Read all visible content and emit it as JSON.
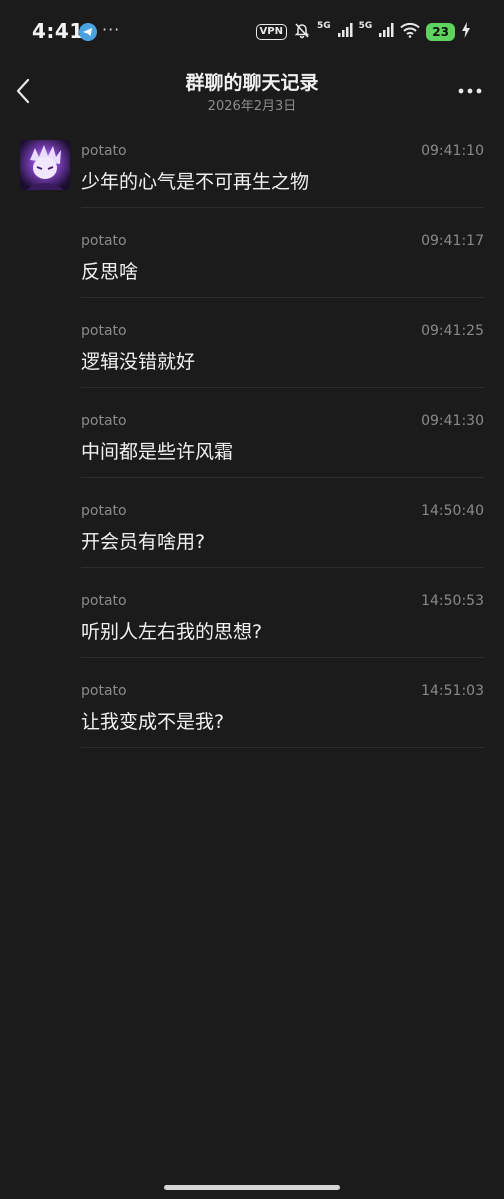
{
  "status_bar": {
    "time": "4:41",
    "more": "···",
    "vpn": "VPN",
    "network_1": "5G",
    "network_2": "5G",
    "battery": "23"
  },
  "header": {
    "title": "群聊的聊天记录",
    "subtitle": "2026年2月3日"
  },
  "messages": [
    {
      "sender": "potato",
      "time": "09:41:10",
      "text": "少年的心气是不可再生之物"
    },
    {
      "sender": "potato",
      "time": "09:41:17",
      "text": "反思啥"
    },
    {
      "sender": "potato",
      "time": "09:41:25",
      "text": "逻辑没错就好"
    },
    {
      "sender": "potato",
      "time": "09:41:30",
      "text": "中间都是些许风霜"
    },
    {
      "sender": "potato",
      "time": "14:50:40",
      "text": "开会员有啥用?"
    },
    {
      "sender": "potato",
      "time": "14:50:53",
      "text": "听别人左右我的思想?"
    },
    {
      "sender": "potato",
      "time": "14:51:03",
      "text": "让我变成不是我?"
    }
  ],
  "colors": {
    "background": "#1b1b1b",
    "battery": "#5fd25f",
    "telegram": "#4aa3df",
    "avatar_accent": "#7a3fb8"
  },
  "icons": {
    "back": "chevron-left-icon",
    "more": "more-horizontal-icon",
    "telegram": "telegram-icon",
    "mute": "bell-off-icon",
    "wifi": "wifi-icon",
    "charging": "bolt-icon"
  }
}
